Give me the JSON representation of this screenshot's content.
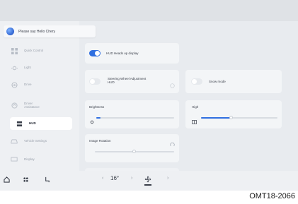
{
  "voice": {
    "prompt": "Please say Hello Chery"
  },
  "sidebar": {
    "items": [
      {
        "label": "Quick Control",
        "icon": "grid-icon"
      },
      {
        "label": "Light",
        "icon": "light-icon"
      },
      {
        "label": "Drive",
        "icon": "steering-wheel-icon"
      },
      {
        "label": "Driver Assistance",
        "icon": "driver-assist-icon"
      },
      {
        "label": "HUD",
        "icon": "hud-icon",
        "active": true
      },
      {
        "label": "Vehicle Settings",
        "icon": "car-icon"
      },
      {
        "label": "Display",
        "icon": "display-icon"
      }
    ]
  },
  "hud": {
    "heads_up_label": "HUD Heads up display",
    "heads_up_on": true,
    "steering_label": "Steering Wheel Adjustment HUD",
    "snow_mode_label": "Snow mode",
    "brightness_label": "Brightness",
    "brightness_level": 0.05,
    "high_label": "High",
    "high_level": 0.4,
    "image_rotation_label": "Image Rotation",
    "image_rotation_level": 0.5
  },
  "bottom_bar": {
    "temperature": "16°",
    "icons": [
      "home-icon",
      "apps-icon",
      "seat-icon",
      "fan-icon"
    ]
  },
  "caption": "OMT18-2066"
}
